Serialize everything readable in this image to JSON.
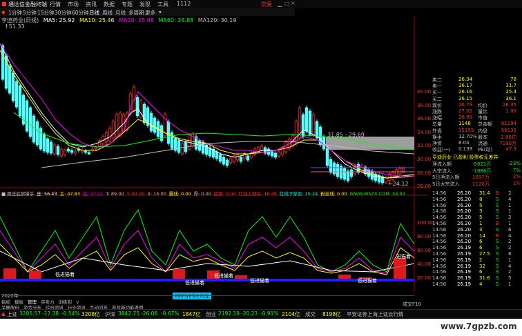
{
  "titlebar": {
    "app_name": "通达信金融终端",
    "menus": [
      "行情",
      "市场",
      "资讯",
      "数据",
      "专题",
      "发现",
      "工具",
      "1112"
    ],
    "trade_label": "交易"
  },
  "periods": {
    "items": [
      "1分钟",
      "5分钟",
      "15分钟",
      "30分钟",
      "60分钟",
      "日线",
      "周线",
      "月线",
      "多周期",
      "更多"
    ],
    "selected": "日线"
  },
  "mainchart": {
    "ma_legend": [
      {
        "label": "亨迪药业(日线)",
        "color": "#c0c0c0"
      },
      {
        "label": "MA5: 25.92",
        "color": "#ffffff"
      },
      {
        "label": "MA10: 25.46",
        "color": "#ffff00"
      },
      {
        "label": "MA20: 25.98",
        "color": "#ff00ff"
      },
      {
        "label": "MA60: 28.88",
        "color": "#00ff00"
      },
      {
        "label": "MA120: 30.19",
        "color": "#c0c0c0"
      }
    ],
    "high_label": "↑51.33",
    "low_label": "←24.12",
    "range_label": "31.85 - 29.69",
    "price_axis": [
      "40.00",
      "38.00",
      "36.00",
      "34.00",
      "32.00",
      "30.00",
      "28.00",
      "26.00"
    ],
    "accent_up": "#ff3232",
    "accent_down": "#54ffff"
  },
  "quote": {
    "rows": [
      {
        "k": "卖二",
        "v1": "26.34",
        "v2": "78",
        "c1": "#ffff00",
        "c2": "#ffff00"
      },
      {
        "k": "卖一",
        "v1": "26.17",
        "v2": "31.7",
        "c1": "#ffff00",
        "c2": "#ffff00"
      },
      {
        "k": "买一",
        "v1": "26.16",
        "v2": "25.4",
        "c1": "#ffff00",
        "c2": "#ffff00"
      },
      {
        "k": "买二",
        "v1": "26.15",
        "v2": "36.1",
        "c1": "#ffff00",
        "c2": "#ffff00"
      },
      {
        "k": "现价",
        "v1": "26.79",
        "v2": "均价",
        "v3": "26.35",
        "c1": "#ff3232"
      },
      {
        "k": "涨跌",
        "v1": "27.02",
        "v2": "量比",
        "v3": "1.00",
        "c1": "#ff3232"
      },
      {
        "k": "涨幅",
        "v1": "26.09",
        "v2": "市值",
        "v3": "",
        "c1": "#ff3232"
      },
      {
        "k": "总量",
        "v1": "1148",
        "v2": "总金额",
        "v3": "91294",
        "c1": "#ffff00"
      },
      {
        "k": "外盘",
        "v1": "35159",
        "v2": "内盘",
        "v3": "56135",
        "c1": "#ff3232"
      },
      {
        "k": "换手",
        "v1": "12.70%",
        "v2": "股本",
        "v3": "2.88亿",
        "c1": "#c0c0c0"
      },
      {
        "k": "净资",
        "v1": "8.04",
        "v2": "流通",
        "v3": "7190万",
        "c1": "#c0c0c0"
      },
      {
        "k": "收益(一)",
        "v1": "0.139",
        "v2": "PE(动)",
        "v3": "47.3",
        "c1": "#c0c0c0"
      }
    ],
    "stock_line": "亨迪药业 已盈利 投票权无差异",
    "flow": [
      {
        "k": "净流入额",
        "v": "-5621万",
        "p": "-23%"
      },
      {
        "k": "大宗流入",
        "v": "-1886万",
        "p": "-7%"
      },
      {
        "k": "5日净流入额",
        "v": "1997万",
        "p": "2%"
      },
      {
        "k": "5日大宗流入",
        "v": "1120万",
        "p": "1%"
      }
    ]
  },
  "indicator": {
    "header": [
      {
        "t": "■ 跟庄底部猎杀",
        "c": "#c0c0c0"
      },
      {
        "t": "庄: 56.43",
        "c": "#ffffff"
      },
      {
        "t": "主: 47.83",
        "c": "#ffff00"
      },
      {
        "t": "控: 37.22",
        "c": "#ff00ff"
      },
      {
        "t": "T: 89.00",
        "c": "#c0c0c0"
      },
      {
        "t": "Y: 97.00",
        "c": "#ff3232"
      },
      {
        "t": "X: 15.00",
        "c": "#c0c0c0"
      },
      {
        "t": "震线: 0.00",
        "c": "#ffff00"
      },
      {
        "t": "界: 0.00",
        "c": "#c0c0c0"
      },
      {
        "t": "底部: 0.00",
        "c": "#ff3232"
      },
      {
        "t": "红线上穿买: 16.49",
        "c": "#ff3232"
      },
      {
        "t": "红线下穿卖: 15.24",
        "c": "#00ffff"
      },
      {
        "t": "粉丝线: 0.00",
        "c": "#ffff00"
      },
      {
        "t": "WWW.WSZX.COM: 54.93",
        "c": "#00ff00"
      }
    ],
    "axis": [
      "100.00",
      "80.00",
      "60.00",
      "40.00",
      "20.00"
    ],
    "signal_label": "低进猫着",
    "signal_label_alt": "进猫着"
  },
  "ticks": {
    "rows": [
      [
        "14:56",
        "26.20",
        "31.4",
        "B",
        "2"
      ],
      [
        "14:56",
        "26.20",
        "8",
        "S",
        "4"
      ],
      [
        "14:56",
        "26.20",
        "5",
        "S",
        "1"
      ],
      [
        "14:56",
        "26.20",
        "3",
        "S",
        "1"
      ],
      [
        "14:56",
        "26.20",
        "5",
        "S",
        "2"
      ],
      [
        "14:56",
        "26.20",
        "1",
        "B",
        "1"
      ],
      [
        "14:56",
        "26.20",
        "3",
        "S",
        "6"
      ],
      [
        "14:56",
        "26.20",
        "14",
        "B",
        "4"
      ],
      [
        "14:56",
        "26.20",
        "6",
        "S",
        "2"
      ],
      [
        "14:56",
        "26.19",
        "6",
        "S",
        "2"
      ],
      [
        "14:56",
        "26.19",
        "27.5",
        "S",
        "8"
      ],
      [
        "14:56",
        "26.19",
        "2",
        "S",
        "1"
      ],
      [
        "14:56",
        "26.19",
        "32",
        "S",
        "4"
      ],
      [
        "14:56",
        "26.19",
        "6",
        "S",
        "2"
      ],
      [
        "14:56",
        "26.19",
        "31.6",
        "S",
        "5"
      ],
      [
        "14:56",
        "26.19",
        "4",
        "S",
        "1"
      ]
    ],
    "footer_label": "成交F10"
  },
  "bottombar": {
    "year": "2022年",
    "date_label": "2023/03/17/五",
    "tabs": [
      "指标",
      "模板",
      "管理",
      "买卖力",
      "训练到",
      "∨",
      "关联股份",
      "资金分布",
      "综合资讯",
      "行业资讯",
      "互动问答",
      "普及新功能说明"
    ]
  },
  "indexbar": [
    {
      "name": "上证",
      "value": "3205.57",
      "chg": "-17.38",
      "pct": "-0.54%",
      "amt": "3208亿"
    },
    {
      "name": "沪深",
      "value": "3842.75",
      "chg": "-26.06",
      "pct": "-0.67%",
      "amt": "1847亿"
    },
    {
      "name": "创业",
      "value": "2192.19",
      "chg": "-20.23",
      "pct": "-0.91%",
      "amt": "2104亿"
    }
  ],
  "indexbar_extra": {
    "deal": "成交",
    "deal_value": "8198亿",
    "broker": "平安证券上海上证云行情"
  },
  "watermark": "www.7gpzb.com"
}
